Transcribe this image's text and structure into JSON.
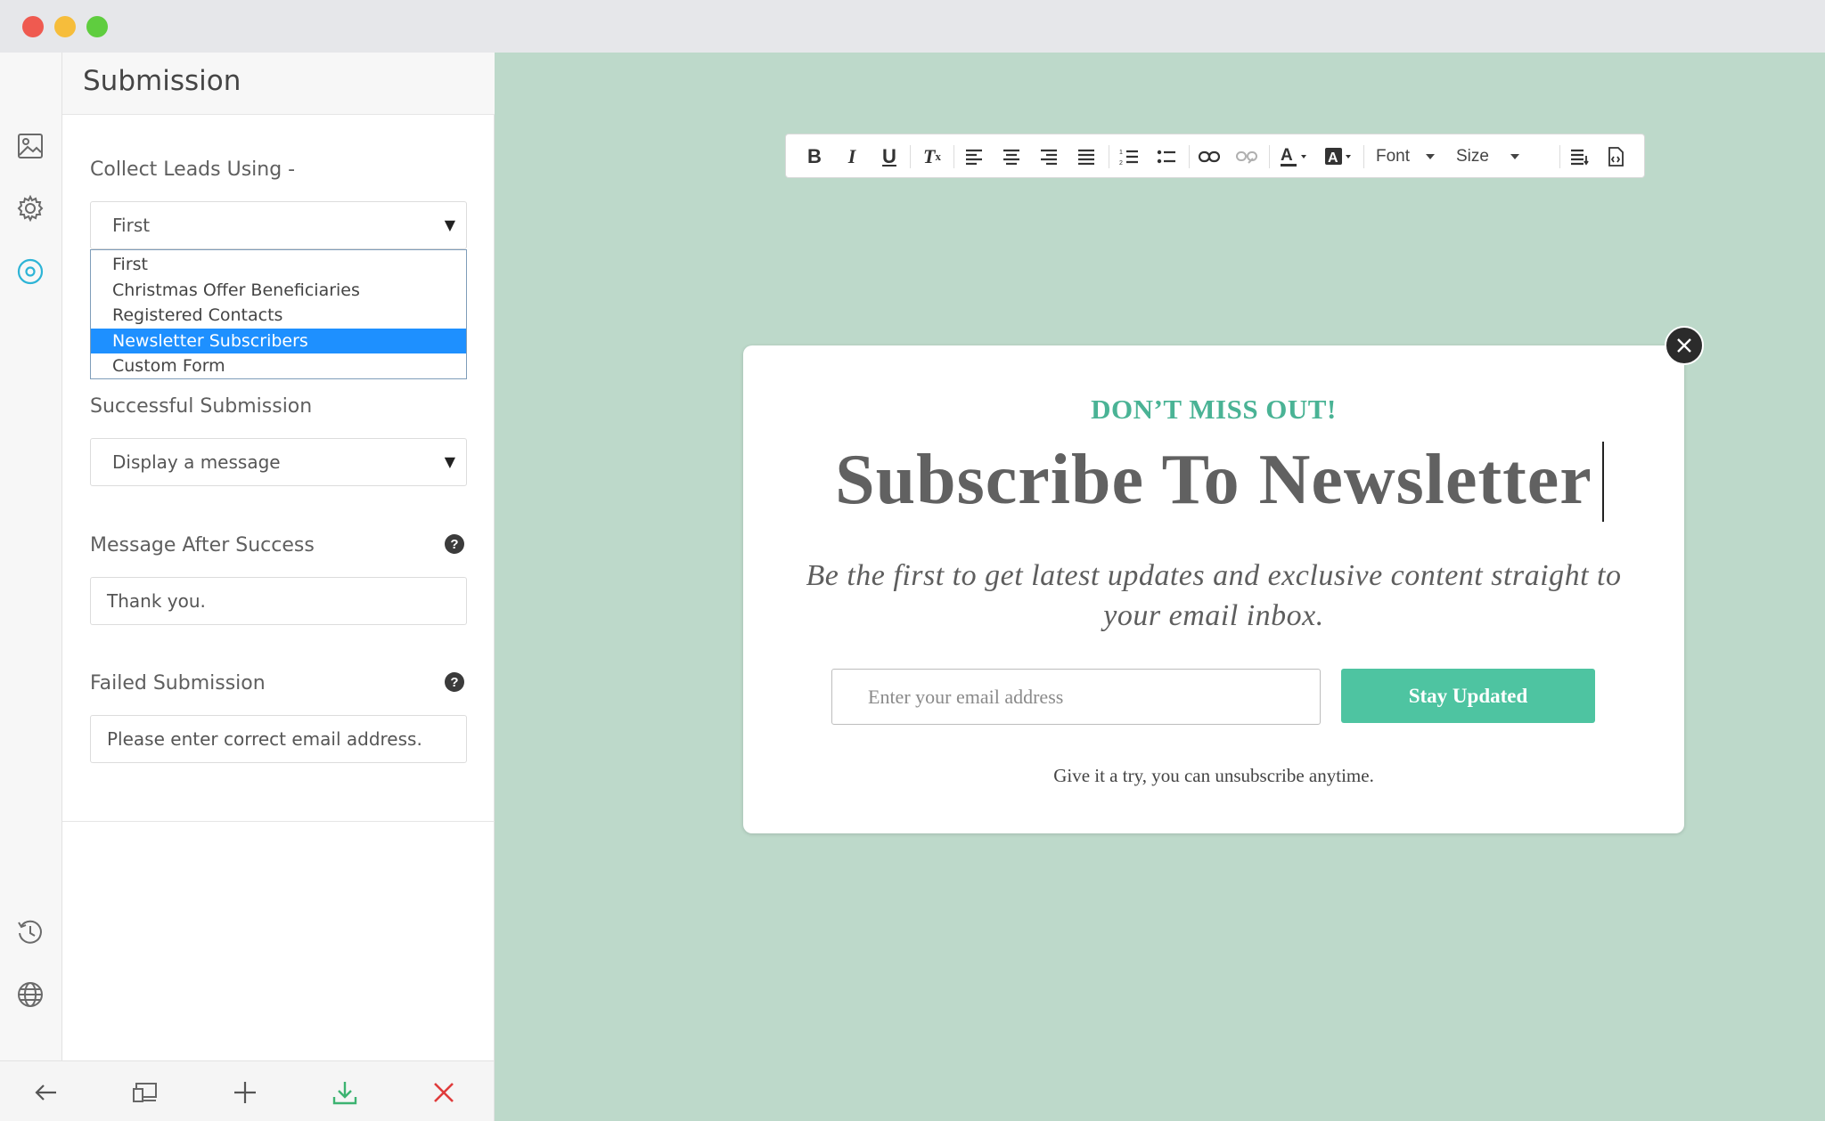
{
  "window": {
    "controls": [
      "close",
      "minimize",
      "maximize"
    ]
  },
  "rail": {
    "icons": [
      "image-icon",
      "gear-icon",
      "target-icon",
      "history-icon",
      "globe-icon"
    ],
    "accent": "#2db4d6"
  },
  "panel": {
    "title": "Submission",
    "collect_label": "Collect Leads Using -",
    "collect_value": "First",
    "collect_options": [
      "First",
      "Christmas Offer Beneficiaries",
      "Registered Contacts",
      "Newsletter Subscribers",
      "Custom Form"
    ],
    "collect_selected_index": 3,
    "success_label": "Successful Submission",
    "success_value": "Display a message",
    "message_label": "Message After Success",
    "message_value": "Thank you.",
    "failed_label": "Failed Submission",
    "failed_value": "Please enter correct email address.",
    "help_glyph": "?"
  },
  "bottombar": {
    "icons": [
      "back-arrow-icon",
      "devices-icon",
      "plus-icon",
      "download-icon",
      "close-icon"
    ],
    "download_color": "#3cb371",
    "close_color": "#e03b3b"
  },
  "editor_toolbar": {
    "font_label": "Font",
    "size_label": "Size"
  },
  "popup": {
    "eyebrow": "DON’T MISS OUT!",
    "headline": "Subscribe To Newsletter",
    "subline": "Be the first to get latest updates and exclusive content straight to your email inbox.",
    "email_placeholder": "Enter your email address",
    "cta_label": "Stay Updated",
    "footnote": "Give it a try, you can unsubscribe anytime.",
    "accent": "#4ab395",
    "button_color": "#4ec4a1",
    "canvas_bg": "#bdd9ca"
  }
}
